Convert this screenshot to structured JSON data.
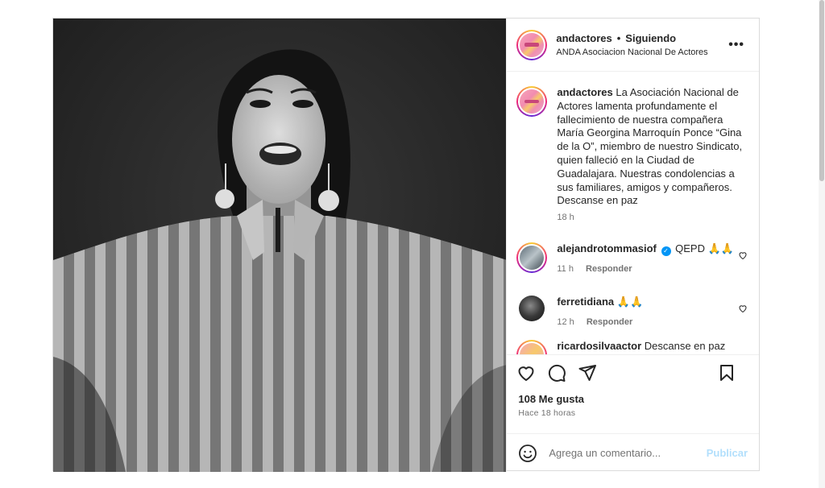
{
  "header": {
    "username": "andactores",
    "separator": "•",
    "follow_state": "Siguiendo",
    "subtitle": "ANDA Asociacion Nacional De Actores",
    "more_icon": "more-horizontal-icon"
  },
  "caption": {
    "username": "andactores",
    "text": "La Asociación Nacional de Actores lamenta profundamente el fallecimiento de nuestra compañera María Georgina Marroquín Ponce “Gina de la O”, miembro de nuestro Sindicato, quien falleció en la Ciudad de Guadalajara. Nuestras condolencias a sus familiares, amigos y compañeros. Descanse en paz",
    "time": "18 h"
  },
  "comments": [
    {
      "username": "alejandrotommasiof",
      "text": "QEPD 🙏🙏",
      "time": "11 h",
      "reply_label": "Responder",
      "verified": true
    },
    {
      "username": "ferretidiana",
      "text": "🙏🙏",
      "time": "12 h",
      "reply_label": "Responder",
      "verified": false
    },
    {
      "username": "ricardosilvaactor",
      "text": "Descanse en paz",
      "time": "",
      "reply_label": "",
      "verified": false
    }
  ],
  "actions": {
    "likes": "108 Me gusta",
    "posted": "Hace 18 horas"
  },
  "composer": {
    "placeholder": "Agrega un comentario...",
    "post_label": "Publicar"
  },
  "colors": {
    "accent": "#0095f6",
    "post_disabled": "#b2dffc",
    "text": "#262626",
    "muted": "#737373",
    "border": "#dbdbdb"
  }
}
